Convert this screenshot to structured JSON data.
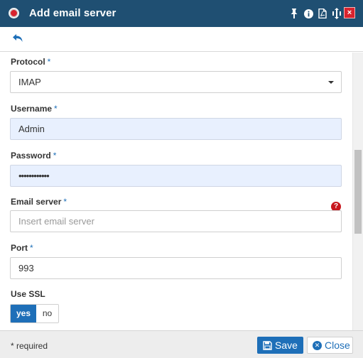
{
  "window": {
    "title": "Add email server",
    "close_glyph": "×",
    "icons": [
      "pin-icon",
      "info-icon",
      "pdf-icon",
      "resize-icon"
    ]
  },
  "form": {
    "protocol": {
      "label": "Protocol",
      "required_mark": "*",
      "value": "IMAP"
    },
    "username": {
      "label": "Username",
      "required_mark": "*",
      "value": "Admin"
    },
    "password": {
      "label": "Password",
      "required_mark": "*",
      "value": "••••••••••••"
    },
    "email_server": {
      "label": "Email server",
      "required_mark": "*",
      "placeholder": "Insert email server",
      "help_glyph": "?"
    },
    "port": {
      "label": "Port",
      "required_mark": "*",
      "value": "993"
    },
    "use_ssl": {
      "label": "Use SSL",
      "yes_label": "yes",
      "no_label": "no",
      "selected": "yes"
    }
  },
  "footer": {
    "required_note": "* required",
    "save_label": "Save",
    "close_label": "Close"
  },
  "colors": {
    "titlebar": "#1f4f72",
    "accent": "#1e6fb8",
    "danger": "#d9232e",
    "autofill": "#e8f0fe"
  }
}
